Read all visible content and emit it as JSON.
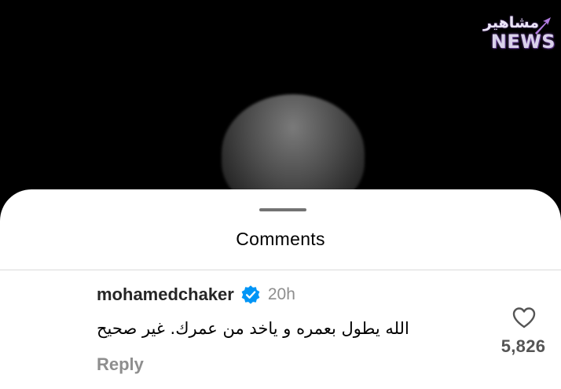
{
  "watermark": {
    "arabic": "مشاهير",
    "latin": "NEWS"
  },
  "sheet": {
    "title": "Comments"
  },
  "comment": {
    "username": "mohamedchaker",
    "verified_icon": "verified-badge-icon",
    "timestamp": "20h",
    "text": "الله يطول بعمره و ياخد من عمرك. غير صحيح",
    "reply_label": "Reply",
    "like_icon": "heart-icon",
    "like_count": "5,826"
  },
  "colors": {
    "sheet_background": "#ffffff",
    "verified_blue": "#0095f6",
    "secondary_text": "#8e8e8e",
    "primary_text": "#262626"
  }
}
